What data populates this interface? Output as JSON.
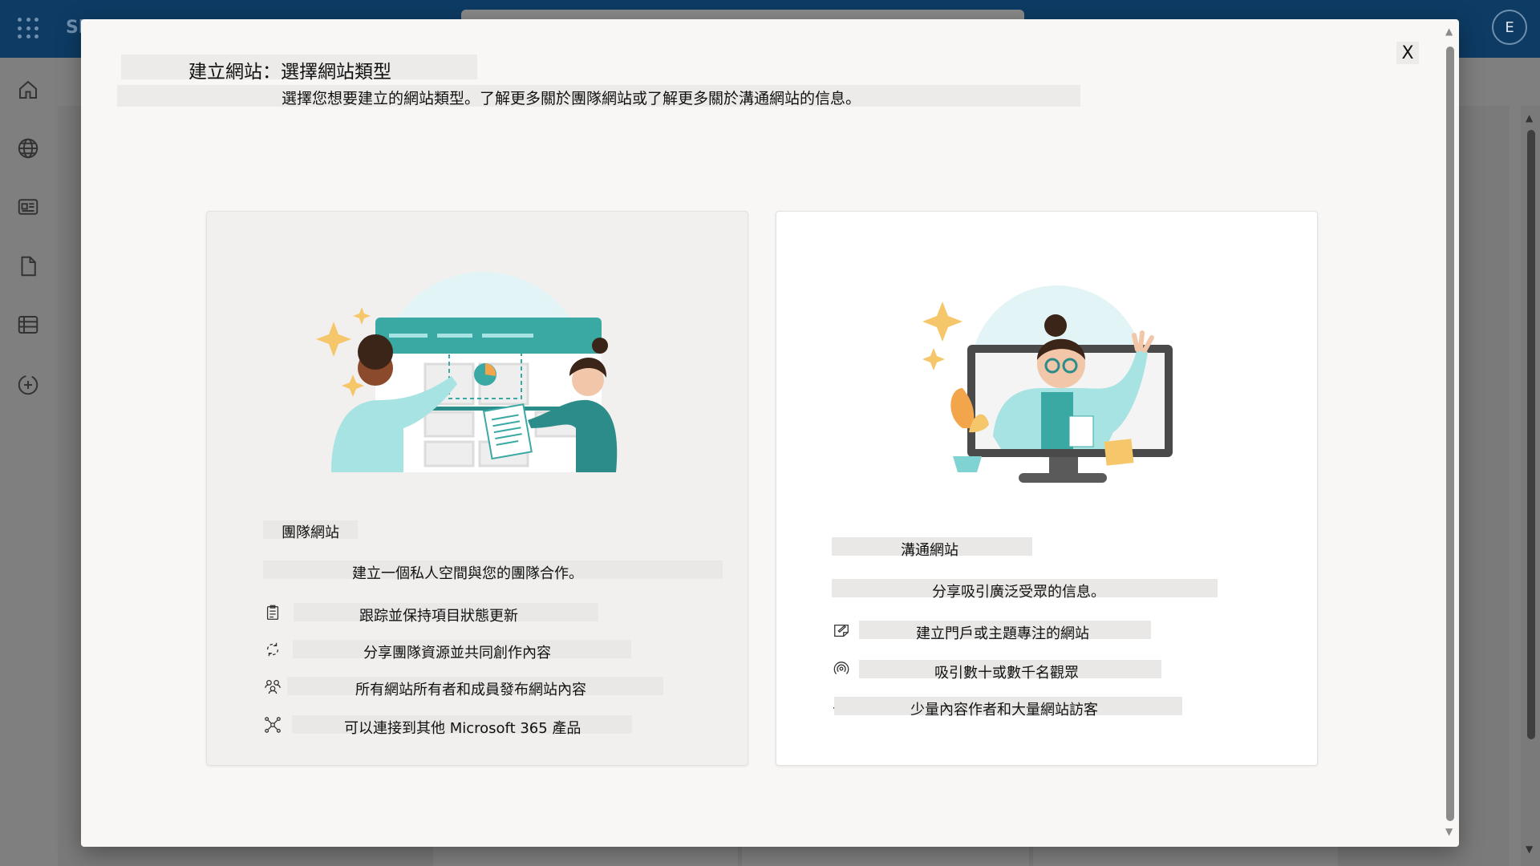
{
  "background_app": {
    "app_abbrev": "Sl",
    "avatar_initial": "E",
    "nav_icons": [
      "home-icon",
      "globe-icon",
      "news-icon",
      "document-icon",
      "list-icon",
      "add-circle-icon"
    ]
  },
  "dialog": {
    "close_label": "X",
    "title": "建立網站：選擇網站類型",
    "subtitle": "選擇您想要建立的網站類型。了解更多關於團隊網站或了解更多關於溝通網站的信息。"
  },
  "team_site": {
    "name": "團隊網站",
    "description": "建立一個私人空間與您的團隊合作。",
    "features": [
      {
        "icon": "clipboard-icon",
        "text": "跟踪並保持項目狀態更新"
      },
      {
        "icon": "sync-icon",
        "text": "分享團隊資源並共同創作內容"
      },
      {
        "icon": "people-icon",
        "text": "所有網站所有者和成員發布網站內容"
      },
      {
        "icon": "connect-icon",
        "text": "可以連接到其他 Microsoft 365 產品"
      }
    ]
  },
  "communication_site": {
    "name": "溝通網站",
    "description": "分享吸引廣泛受眾的信息。",
    "features": [
      {
        "icon": "notepad-icon",
        "text": "建立門戶或主題專注的網站"
      },
      {
        "icon": "broadcast-icon",
        "text": "吸引數十或數千名觀眾"
      },
      {
        "icon": "dot-icon",
        "text": "少量內容作者和大量網站訪客"
      }
    ]
  },
  "colors": {
    "topbar": "#0d3b64",
    "teal": "#3aa9a3",
    "dark_teal": "#2b8c8a",
    "light_teal": "#a8e3e3",
    "card_team_bg": "#f1f0ef",
    "card_comm_bg": "#ffffff",
    "dialog_bg": "#f8f7f6"
  }
}
